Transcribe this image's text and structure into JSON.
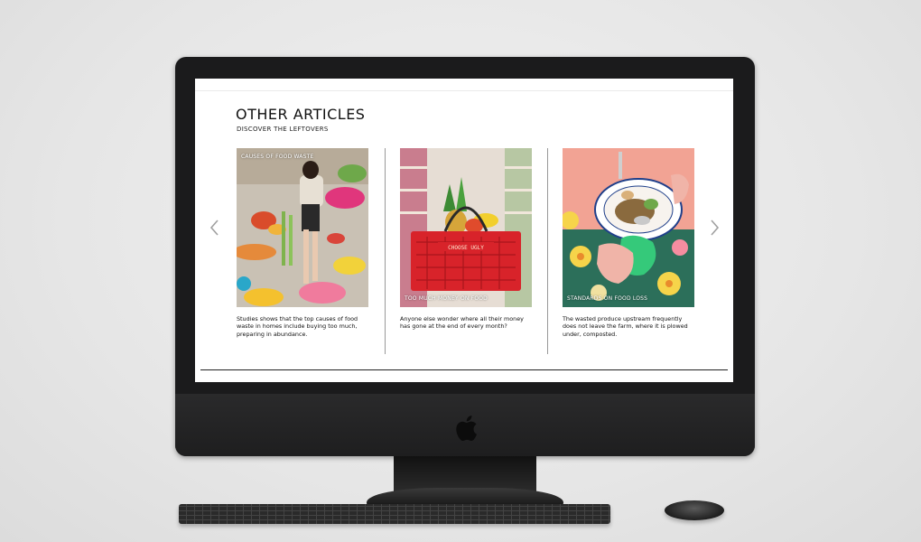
{
  "section": {
    "title": "OTHER ARTICLES",
    "subtitle": "DISCOVER THE LEFTOVERS"
  },
  "carousel": {
    "prev_icon": "chevron-left-icon",
    "next_icon": "chevron-right-icon"
  },
  "cards": [
    {
      "tag": "CAUSES OF FOOD WASTE",
      "tag_position": "top",
      "image": "feast-table-photo",
      "text": "Studies shows that the top causes of food waste in homes include buying too much, preparing in abundance."
    },
    {
      "tag": "TOO MUCH MONEY ON FOOD",
      "tag_position": "bottom",
      "image": "shopping-basket-photo",
      "basket_label": "CHOOSE UGLY",
      "text": "Anyone else wonder where all their money has gone at the end of every month?"
    },
    {
      "tag": "STANDARDS ON FOOD LOSS",
      "tag_position": "bottom",
      "image": "leftovers-bowl-photo",
      "text": "The wasted produce upstream frequently does not leave the farm, where it is plowed under, composted."
    }
  ],
  "colors": {
    "basket_red": "#d8232a",
    "screen_bg": "#ffffff",
    "bezel": "#1b1b1c"
  }
}
